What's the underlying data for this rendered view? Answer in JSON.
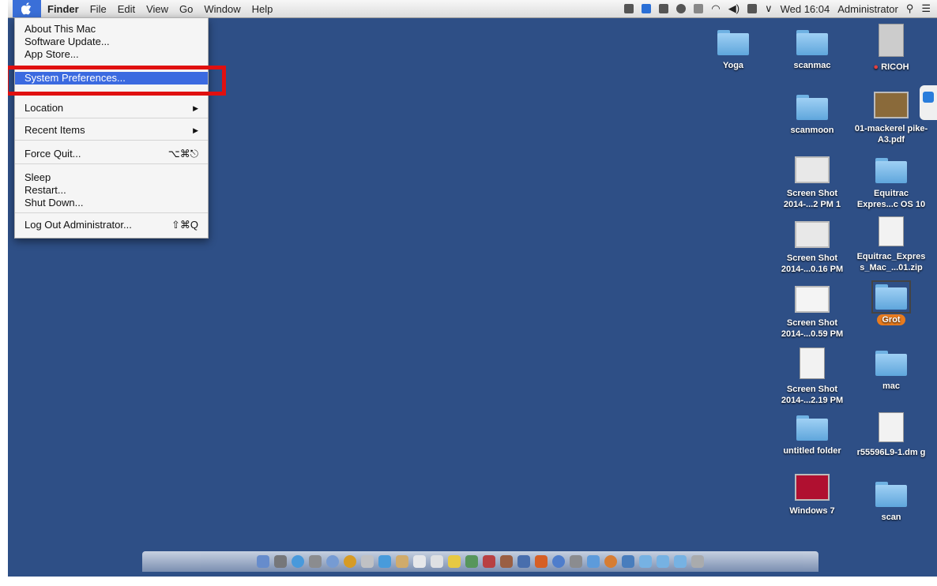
{
  "menubar": {
    "app": "Finder",
    "menus": [
      "File",
      "Edit",
      "View",
      "Go",
      "Window",
      "Help"
    ],
    "clock": "Wed 16:04",
    "user": "Administrator"
  },
  "apple_menu": {
    "about": "About This Mac",
    "software_update": "Software Update...",
    "app_store": "App Store...",
    "system_preferences": "System Preferences...",
    "location": "Location",
    "recent_items": "Recent Items",
    "force_quit": "Force Quit...",
    "force_quit_shortcut": "⌥⌘⎋",
    "sleep": "Sleep",
    "restart": "Restart...",
    "shut_down": "Shut Down...",
    "log_out": "Log Out Administrator...",
    "log_out_shortcut": "⇧⌘Q",
    "submenu_arrow": "▶"
  },
  "desktop_icons": {
    "yoga": "Yoga",
    "scanmac": "scanmac",
    "ricoh": "RICOH",
    "scanmoon": "scanmoon",
    "mackerel": "01-mackerel pike-A3.pdf",
    "screenshot1": "Screen Shot 2014-...2 PM 1",
    "equitrac": "Equitrac Expres...c OS 10",
    "screenshot2": "Screen Shot 2014-...0.16 PM",
    "equitrac_zip": "Equitrac_Expres s_Mac_...01.zip",
    "screenshot3": "Screen Shot 2014-...0.59 PM",
    "grot": "Grot",
    "screenshot4": "Screen Shot 2014-...2.19 PM",
    "mac": "mac",
    "untitled": "untitled folder",
    "dmg": "r55596L9-1.dm g",
    "windows7": "Windows 7",
    "scan": "scan"
  },
  "colors": {
    "desktop": "#2e4f86",
    "highlight": "#e01010",
    "selection": "#3b6ae0"
  }
}
